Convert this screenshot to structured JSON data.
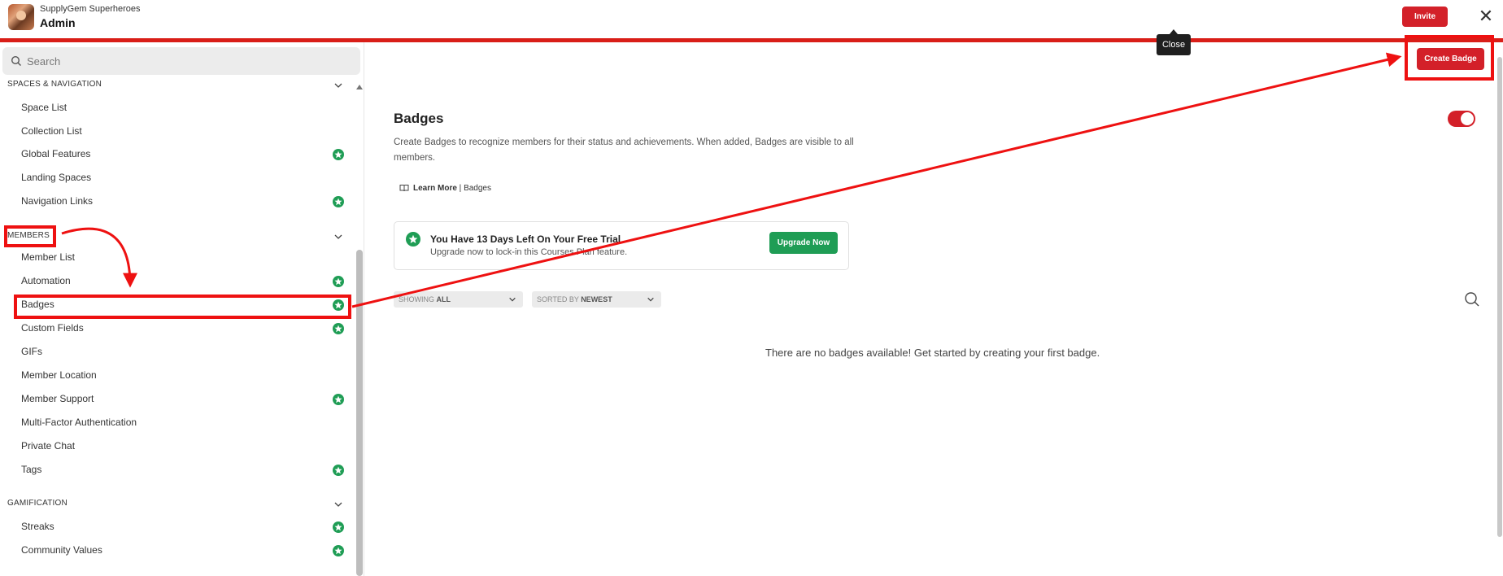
{
  "header": {
    "org_name": "SupplyGem Superheroes",
    "title": "Admin",
    "invite_label": "Invite",
    "close_tooltip": "Close"
  },
  "sidebar": {
    "search_placeholder": "Search",
    "sections": [
      {
        "title": "SPACES & NAVIGATION",
        "items": [
          {
            "label": "Space List",
            "premium": false
          },
          {
            "label": "Collection List",
            "premium": false
          },
          {
            "label": "Global Features",
            "premium": true
          },
          {
            "label": "Landing Spaces",
            "premium": false
          },
          {
            "label": "Navigation Links",
            "premium": true
          }
        ]
      },
      {
        "title": "MEMBERS",
        "items": [
          {
            "label": "Member List",
            "premium": false
          },
          {
            "label": "Automation",
            "premium": true
          },
          {
            "label": "Badges",
            "premium": true
          },
          {
            "label": "Custom Fields",
            "premium": true
          },
          {
            "label": "GIFs",
            "premium": false
          },
          {
            "label": "Member Location",
            "premium": false
          },
          {
            "label": "Member Support",
            "premium": true
          },
          {
            "label": "Multi-Factor Authentication",
            "premium": false
          },
          {
            "label": "Private Chat",
            "premium": false
          },
          {
            "label": "Tags",
            "premium": true
          }
        ]
      },
      {
        "title": "GAMIFICATION",
        "items": [
          {
            "label": "Streaks",
            "premium": true
          },
          {
            "label": "Community Values",
            "premium": true
          }
        ]
      }
    ]
  },
  "main": {
    "create_label": "Create Badge",
    "title": "Badges",
    "description": "Create Badges to recognize members for their status and achievements. When added, Badges are visible to all members.",
    "learn_more": "Learn More",
    "learn_sep": " | ",
    "learn_topic": "Badges",
    "trial": {
      "title": "You Have 13 Days Left On Your Free Trial",
      "subtitle": "Upgrade now to lock-in this Courses Plan feature.",
      "button": "Upgrade Now"
    },
    "filter_show_prefix": "SHOWING ",
    "filter_show_value": "ALL",
    "filter_sort_prefix": "SORTED BY ",
    "filter_sort_value": "NEWEST",
    "empty_message": "There are no badges available! Get started by creating your first badge.",
    "toggle_on": true
  },
  "colors": {
    "brand_red": "#d32029",
    "premium_green": "#1f9d55",
    "annotation_red": "#e11111"
  }
}
